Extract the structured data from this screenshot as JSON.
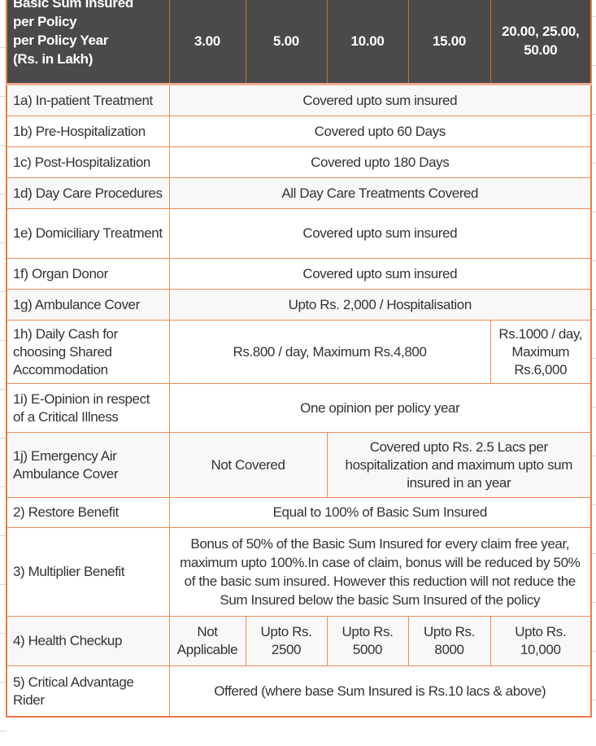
{
  "table": {
    "header": {
      "label": [
        "Basic Sum Insured",
        "per Policy",
        "per Policy Year",
        "(Rs. in Lakh)"
      ],
      "columns": [
        "3.00",
        "5.00",
        "10.00",
        "15.00",
        "20.00, 25.00, 50.00"
      ]
    },
    "rows": [
      {
        "label": "1a) In-patient Treatment",
        "value": "Covered upto sum insured"
      },
      {
        "label": "1b) Pre-Hospitalization",
        "value": "Covered upto 60 Days"
      },
      {
        "label": "1c) Post-Hospitalization",
        "value": "Covered upto 180 Days"
      },
      {
        "label": "1d) Day Care Procedures",
        "value": "All Day Care Treatments Covered"
      },
      {
        "label": "1e) Domiciliary Treatment",
        "value": "Covered upto sum insured"
      },
      {
        "label": "1f) Organ Donor",
        "value": "Covered upto sum insured"
      },
      {
        "label": "1g) Ambulance Cover",
        "value": "Upto Rs. 2,000 / Hospitalisation"
      },
      {
        "label": "1h)  Daily Cash for choosing Shared Accommodation",
        "value_3_to_15": "Rs.800 / day, Maximum Rs.4,800",
        "value_20_plus": "Rs.1000 / day, Maximum Rs.6,000"
      },
      {
        "label": "1i) E-Opinion in respect of a Critical Illness",
        "value": "One opinion per policy year"
      },
      {
        "label": "1j) Emergency Air Ambulance Cover",
        "value_3_to_5": "Not Covered",
        "value_10_plus": "Covered upto Rs. 2.5 Lacs per hospitalization and maximum upto sum insured in an year"
      },
      {
        "label": "2) Restore Benefit",
        "value": "Equal to 100% of Basic Sum Insured"
      },
      {
        "label": "3) Multiplier Benefit",
        "value": "Bonus of 50% of the Basic Sum Insured for every claim free year, maximum upto 100%.In case of claim, bonus will be reduced by 50% of the basic sum insured. However this reduction will not reduce the Sum Insured below the basic Sum Insured of the policy"
      },
      {
        "label": "4) Health Checkup",
        "values": [
          "Not Applicable",
          "Upto Rs. 2500",
          "Upto Rs. 5000",
          "Upto Rs. 8000",
          "Upto Rs. 10,000"
        ]
      },
      {
        "label": "5) Critical Advantage Rider",
        "value": "Offered (where base Sum Insured is Rs.10 lacs & above)"
      }
    ]
  },
  "colors": {
    "header_bg": "#4a4a4c",
    "header_text": "#ffffff",
    "border_accent": "#ee7a45",
    "body_text": "#333333",
    "alt_row_bg": "#f8f8f8"
  }
}
